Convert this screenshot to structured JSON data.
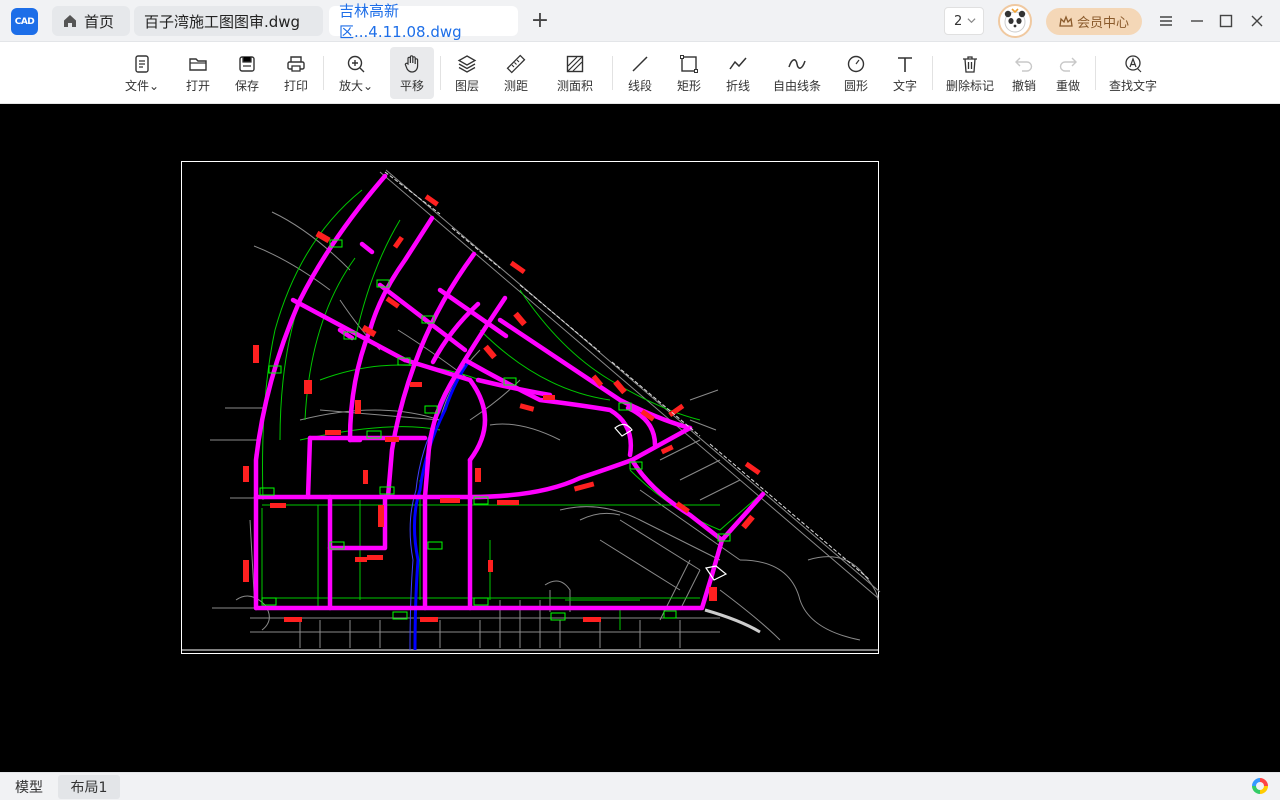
{
  "app": {
    "logo_text": "CAD",
    "home_tab": "首页",
    "tabs": [
      {
        "label": "百子湾施工图图审.dwg",
        "active": false
      },
      {
        "label": "吉林高新区...4.11.08.dwg",
        "active": true
      }
    ],
    "add_tab": "+",
    "window_count": "2",
    "vip_label": "会员中心"
  },
  "toolbar": {
    "items": [
      {
        "label": "文件",
        "icon": "file-icon",
        "dropdown": true
      },
      {
        "label": "打开",
        "icon": "folder-open-icon"
      },
      {
        "label": "保存",
        "icon": "save-icon"
      },
      {
        "label": "打印",
        "icon": "printer-icon"
      },
      {
        "label": "放大",
        "icon": "zoom-in-icon",
        "dropdown": true
      },
      {
        "label": "平移",
        "icon": "pan-hand-icon",
        "active": true
      },
      {
        "label": "图层",
        "icon": "layers-icon"
      },
      {
        "label": "测距",
        "icon": "ruler-icon"
      },
      {
        "label": "测面积",
        "icon": "area-icon"
      },
      {
        "label": "线段",
        "icon": "line-icon"
      },
      {
        "label": "矩形",
        "icon": "rectangle-icon"
      },
      {
        "label": "折线",
        "icon": "polyline-icon"
      },
      {
        "label": "自由线条",
        "icon": "freehand-icon"
      },
      {
        "label": "圆形",
        "icon": "circle-icon"
      },
      {
        "label": "文字",
        "icon": "text-icon"
      },
      {
        "label": "删除标记",
        "icon": "trash-icon"
      },
      {
        "label": "撤销",
        "icon": "undo-icon",
        "disabled": true
      },
      {
        "label": "重做",
        "icon": "redo-icon",
        "disabled": true
      },
      {
        "label": "查找文字",
        "icon": "find-text-icon"
      }
    ]
  },
  "status": {
    "tabs": [
      {
        "label": "模型",
        "active": false
      },
      {
        "label": "布局1",
        "active": true
      }
    ]
  },
  "colors": {
    "canvas_bg": "#000000",
    "road_highlight": "#ff00ff",
    "label_red": "#ff2020",
    "label_green": "#00ff00",
    "river_blue": "#0000ff",
    "accent": "#1d6ee8"
  }
}
